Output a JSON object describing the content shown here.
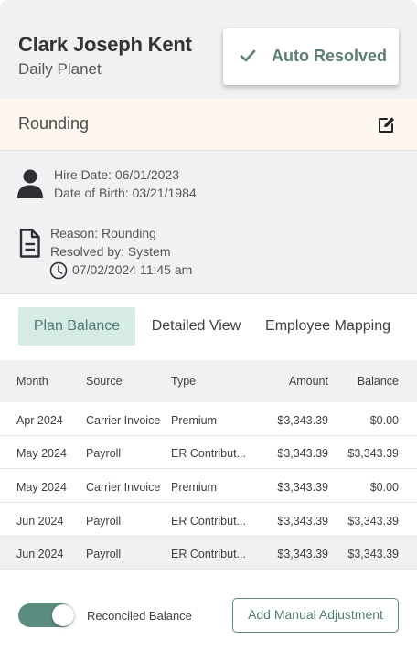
{
  "employee": {
    "name": "Clark Joseph Kent",
    "company": "Daily Planet"
  },
  "status_button": {
    "label": "Auto Resolved",
    "icon": "check-icon"
  },
  "category": {
    "label": "Rounding",
    "edit_icon": "edit-icon"
  },
  "info": {
    "hire_date": "Hire Date: 06/01/2023",
    "birth_date": "Date of Birth: 03/21/1984",
    "reason": "Reason: Rounding",
    "resolved_by": "Resolved by: System",
    "resolved_at": "07/02/2024 11:45 am"
  },
  "tabs": [
    {
      "label": "Plan Balance",
      "active": true
    },
    {
      "label": "Detailed View",
      "active": false
    },
    {
      "label": "Employee Mapping",
      "active": false
    }
  ],
  "table": {
    "headers": [
      "Month",
      "Source",
      "Type",
      "Amount",
      "Balance"
    ],
    "rows": [
      [
        "Apr 2024",
        "Carrier Invoice",
        "Premium",
        "$3,343.39",
        "$0.00"
      ],
      [
        "May 2024",
        "Payroll",
        "ER Contribut...",
        "$3,343.39",
        "$3,343.39"
      ],
      [
        "May 2024",
        "Carrier Invoice",
        "Premium",
        "$3,343.39",
        "$0.00"
      ],
      [
        "Jun 2024",
        "Payroll",
        "ER Contribut...",
        "$3,343.39",
        "$3,343.39"
      ],
      [
        "Jun 2024",
        "Payroll",
        "ER Contribut...",
        "$3,343.39",
        "$3,343.39"
      ]
    ]
  },
  "footer": {
    "toggle_label": "Reconciled Balance",
    "toggle_on": true,
    "adjust_button": "Add Manual Adjustment"
  },
  "colors": {
    "accent": "#5b8c80",
    "accent_text": "#4f7d72",
    "tab_active_bg": "#d6ebe6",
    "header_bg": "#f1f1f4",
    "category_bg": "#fdf7f0"
  }
}
